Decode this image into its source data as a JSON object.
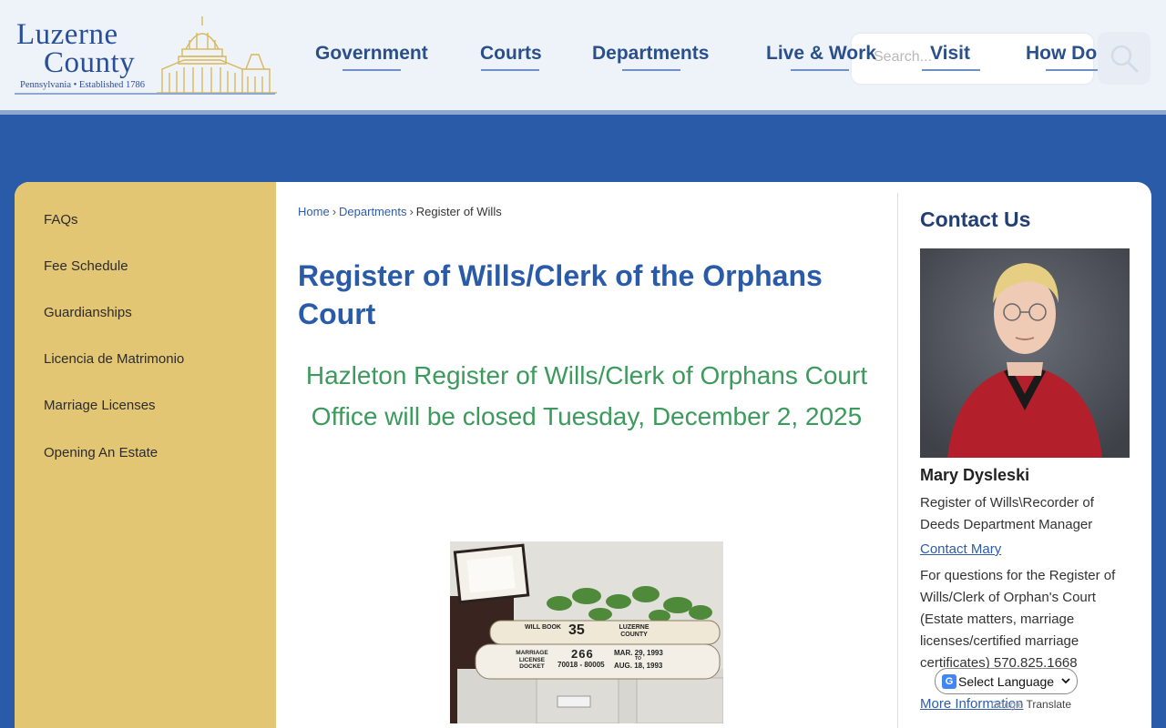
{
  "logo": {
    "line1": "Luzerne",
    "line2": "County",
    "tagline": "Pennsylvania • Established 1786"
  },
  "nav": {
    "items": [
      {
        "label": "Government"
      },
      {
        "label": "Courts"
      },
      {
        "label": "Departments"
      },
      {
        "label": "Live & Work"
      },
      {
        "label": "Visit"
      },
      {
        "label": "How Do I..."
      }
    ]
  },
  "search": {
    "placeholder": "Search...",
    "icon": "search-icon"
  },
  "sidebar": {
    "items": [
      {
        "label": "FAQs"
      },
      {
        "label": "Fee Schedule"
      },
      {
        "label": "Guardianships"
      },
      {
        "label": "Licencia de Matrimonio"
      },
      {
        "label": "Marriage Licenses"
      },
      {
        "label": "Opening An Estate"
      }
    ]
  },
  "breadcrumb": {
    "home": "Home",
    "section": "Departments",
    "current": "Register of Wills",
    "separator": "›"
  },
  "main": {
    "title": "Register of Wills/Clerk of the Orphans Court",
    "notice": "Hazleton Register of Wills/Clerk of Orphans Court Office will be closed Tuesday, December 2, 2025"
  },
  "photo_labels": {
    "book1_left": "WILL BOOK",
    "book1_num": "35",
    "book1_right": "LUZERNE COUNTY",
    "book2_left": "MARRIAGE LICENSE DOCKET",
    "book2_num": "266",
    "book2_range": "70018 - 80005",
    "book2_date1": "MAR. 29, 1993",
    "book2_to": "TO",
    "book2_date2": "AUG. 18, 1993"
  },
  "contact": {
    "heading": "Contact Us",
    "name": "Mary Dysleski",
    "role": "Register of Wills\\Recorder of Deeds Department Manager",
    "contact_link": "Contact Mary",
    "text": "For questions for the Register of Wills/Clerk of Orphan's Court (Estate matters, marriage licenses/certified marriage certificates) 570.825.1668",
    "more_link": "More Information"
  },
  "translate": {
    "select_label": "Select Language",
    "powered_by": "Translate",
    "powered_brand": "Google"
  },
  "colors": {
    "brand_blue": "#2a5ba8",
    "sidebar_gold": "#e3c674",
    "notice_green": "#3c9a5c",
    "link_blue": "#2f5ca8"
  }
}
